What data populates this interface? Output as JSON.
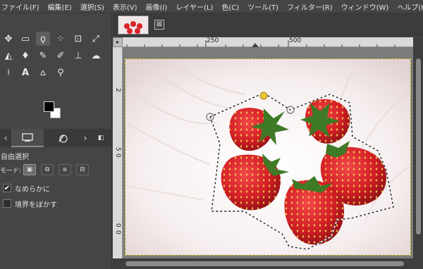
{
  "menu": [
    "ファイル(F)",
    "編集(E)",
    "選択(S)",
    "表示(V)",
    "画像(I)",
    "レイヤー(L)",
    "色(C)",
    "ツール(T)",
    "フィルター(R)",
    "ウィンドウ(W)",
    "ヘルプ(H)"
  ],
  "tools": {
    "move": "✥",
    "rect_select": "▭",
    "free_select": "ϙ",
    "fuzzy_select": "⁘",
    "crop": "⊡",
    "transform": "⤢",
    "bucket": "◭",
    "ink": "♦",
    "paintbrush": "✎",
    "eraser": "✐",
    "clone": "⊥",
    "smudge": "☁",
    "paths": "⍿",
    "text": "A",
    "color_picker": "⩟",
    "zoom": "⚲"
  },
  "tool_options": {
    "title": "自由選択",
    "mode_label": "モード:",
    "antialias_label": "なめらかに",
    "antialias_checked": true,
    "feather_label": "境界をぼかす",
    "feather_checked": false
  },
  "ruler": {
    "h_ticks": [
      "250",
      "500"
    ],
    "v_ticks": [
      "2",
      "5",
      "0",
      "0",
      "0"
    ]
  },
  "image_tab": {
    "close_glyph": "⊠"
  },
  "colors": {
    "foreground": "#000000",
    "background": "#ffffff",
    "accent_selection": "#d4c02a"
  }
}
